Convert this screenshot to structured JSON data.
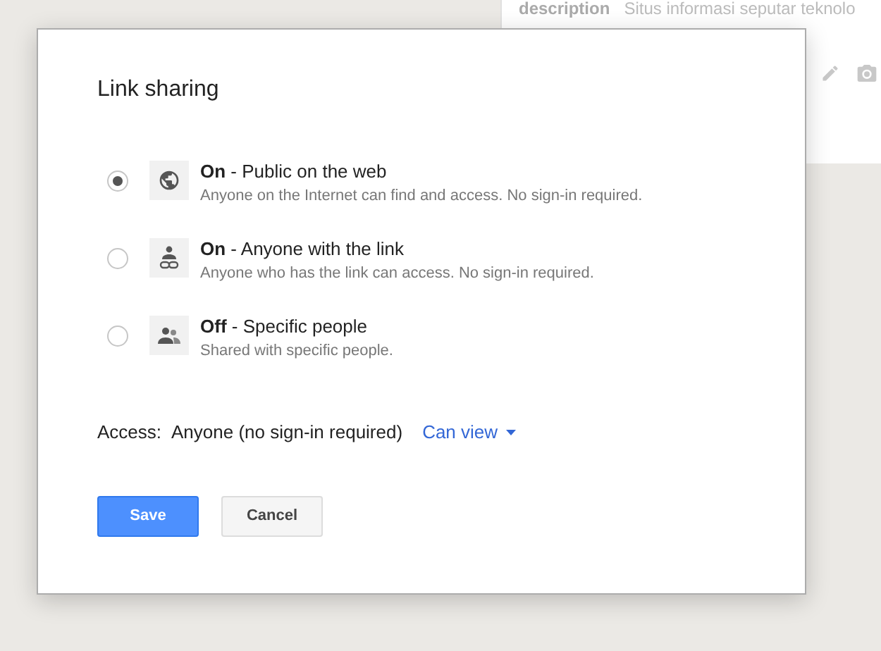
{
  "background_panel": {
    "label": "description",
    "value": "Situs informasi seputar teknolo"
  },
  "dialog": {
    "title": "Link sharing",
    "options": [
      {
        "kind": "globe",
        "title": "**On** - Public on the web",
        "description": "Anyone on the Internet can find and access. No sign-in required.",
        "selected": true
      },
      {
        "kind": "link",
        "title": "**On** - Anyone with the link",
        "description": "Anyone who has the link can access. No sign-in required.",
        "selected": false
      },
      {
        "kind": "people",
        "title": "**Off** - Specific people",
        "description": "Shared with specific people.",
        "selected": false
      }
    ],
    "access_label": "Access:",
    "access_value": "Anyone (no sign-in required)",
    "permission": "Can view",
    "buttons": [
      {
        "kind": "primary",
        "label": "Save"
      },
      {
        "kind": "secondary",
        "label": "Cancel"
      }
    ]
  }
}
